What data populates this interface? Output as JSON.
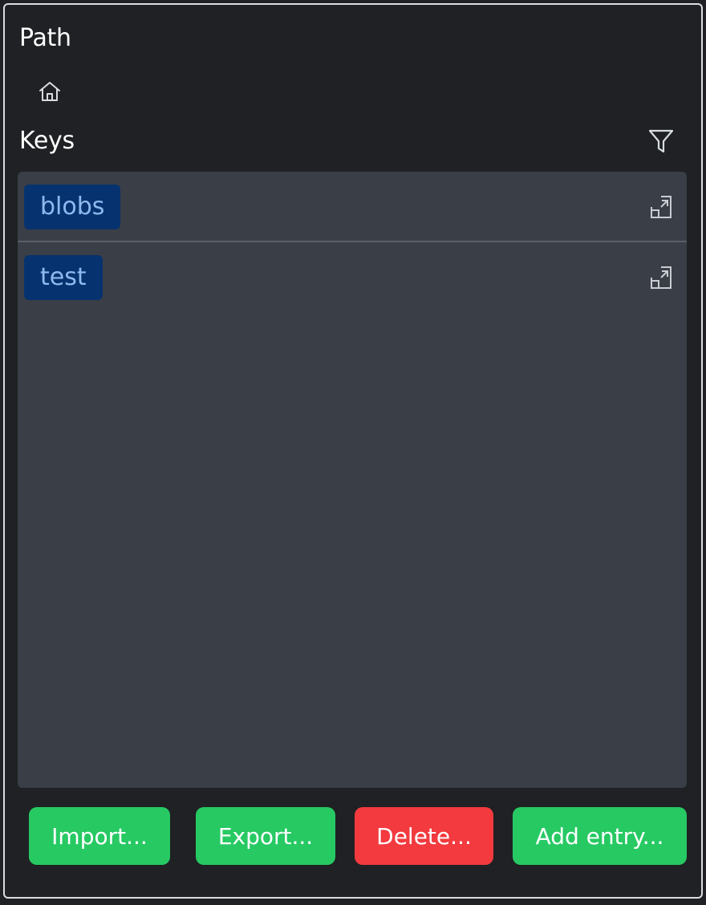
{
  "path_section": {
    "title": "Path",
    "home_icon": "home-icon"
  },
  "keys_section": {
    "title": "Keys",
    "filter_icon": "filter-icon",
    "items": [
      {
        "label": "blobs",
        "open_icon": "open-in-new-icon"
      },
      {
        "label": "test",
        "open_icon": "open-in-new-icon"
      }
    ]
  },
  "actions": {
    "import_label": "Import...",
    "export_label": "Export...",
    "delete_label": "Delete...",
    "add_label": "Add entry..."
  },
  "colors": {
    "background": "#1f2124",
    "list_background": "#3a3e47",
    "badge_background": "#06336f",
    "badge_text": "#8fb9ef",
    "success": "#27c963",
    "danger": "#f23a3f"
  }
}
